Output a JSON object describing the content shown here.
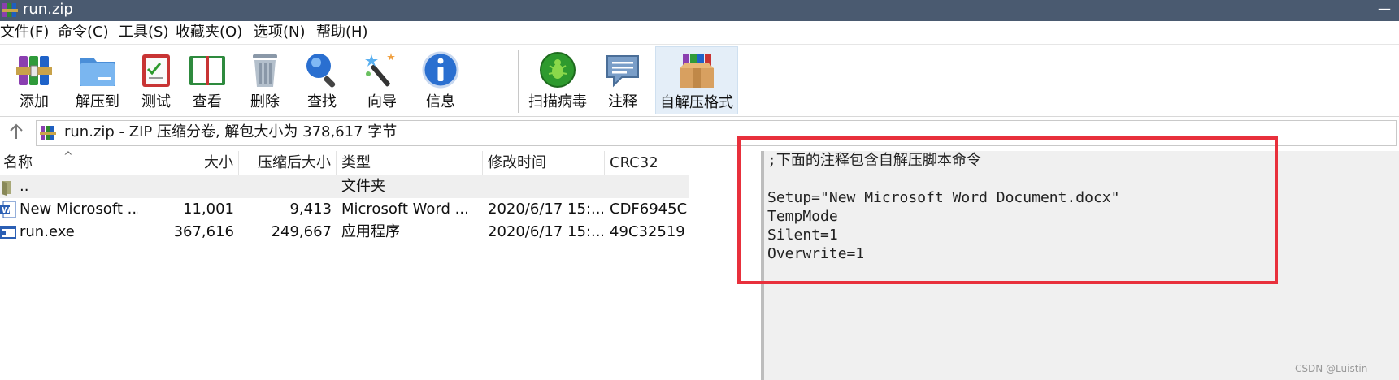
{
  "window": {
    "title": "run.zip",
    "icon": "winrar-books-icon",
    "controls": [
      "—"
    ]
  },
  "menu": [
    {
      "label": "文件(F)"
    },
    {
      "label": "命令(C)"
    },
    {
      "label": "工具(S)"
    },
    {
      "label": "收藏夹(O)"
    },
    {
      "label": "选项(N)"
    },
    {
      "label": "帮助(H)"
    }
  ],
  "toolbar": [
    {
      "label": "添加",
      "icon": "add-archive-icon"
    },
    {
      "label": "解压到",
      "icon": "extract-to-folder-icon"
    },
    {
      "label": "测试",
      "icon": "test-clipboard-icon"
    },
    {
      "label": "查看",
      "icon": "view-book-icon"
    },
    {
      "label": "删除",
      "icon": "delete-trash-icon"
    },
    {
      "label": "查找",
      "icon": "find-magnifier-icon"
    },
    {
      "label": "向导",
      "icon": "wizard-wand-icon"
    },
    {
      "label": "信息",
      "icon": "info-icon"
    },
    {
      "label": "扫描病毒",
      "icon": "virus-scan-icon"
    },
    {
      "label": "注释",
      "icon": "comment-icon"
    },
    {
      "label": "自解压格式",
      "icon": "sfx-box-icon",
      "active": true
    }
  ],
  "address": {
    "text": "run.zip - ZIP 压缩分卷, 解包大小为 378,617 字节"
  },
  "columns": [
    {
      "label": "名称"
    },
    {
      "label": "大小"
    },
    {
      "label": "压缩后大小"
    },
    {
      "label": "类型"
    },
    {
      "label": "修改时间"
    },
    {
      "label": "CRC32"
    }
  ],
  "files": [
    {
      "name": "..",
      "size": "",
      "packed": "",
      "type": "文件夹",
      "modified": "",
      "crc": "",
      "icon": "folder-icon"
    },
    {
      "name": "New Microsoft ...",
      "size": "11,001",
      "packed": "9,413",
      "type": "Microsoft Word ...",
      "modified": "2020/6/17 15:...",
      "crc": "CDF6945C",
      "icon": "word-doc-icon"
    },
    {
      "name": "run.exe",
      "size": "367,616",
      "packed": "249,667",
      "type": "应用程序",
      "modified": "2020/6/17 15:...",
      "crc": "49C32519",
      "icon": "exe-app-icon"
    }
  ],
  "comment": {
    "lines": [
      ";下面的注释包含自解压脚本命令",
      "",
      "Setup=\"New Microsoft Word Document.docx\"",
      "TempMode",
      "Silent=1",
      "Overwrite=1"
    ]
  },
  "annotation": {
    "highlight_color": "#e8303c"
  },
  "watermark": "CSDN @Luistin"
}
